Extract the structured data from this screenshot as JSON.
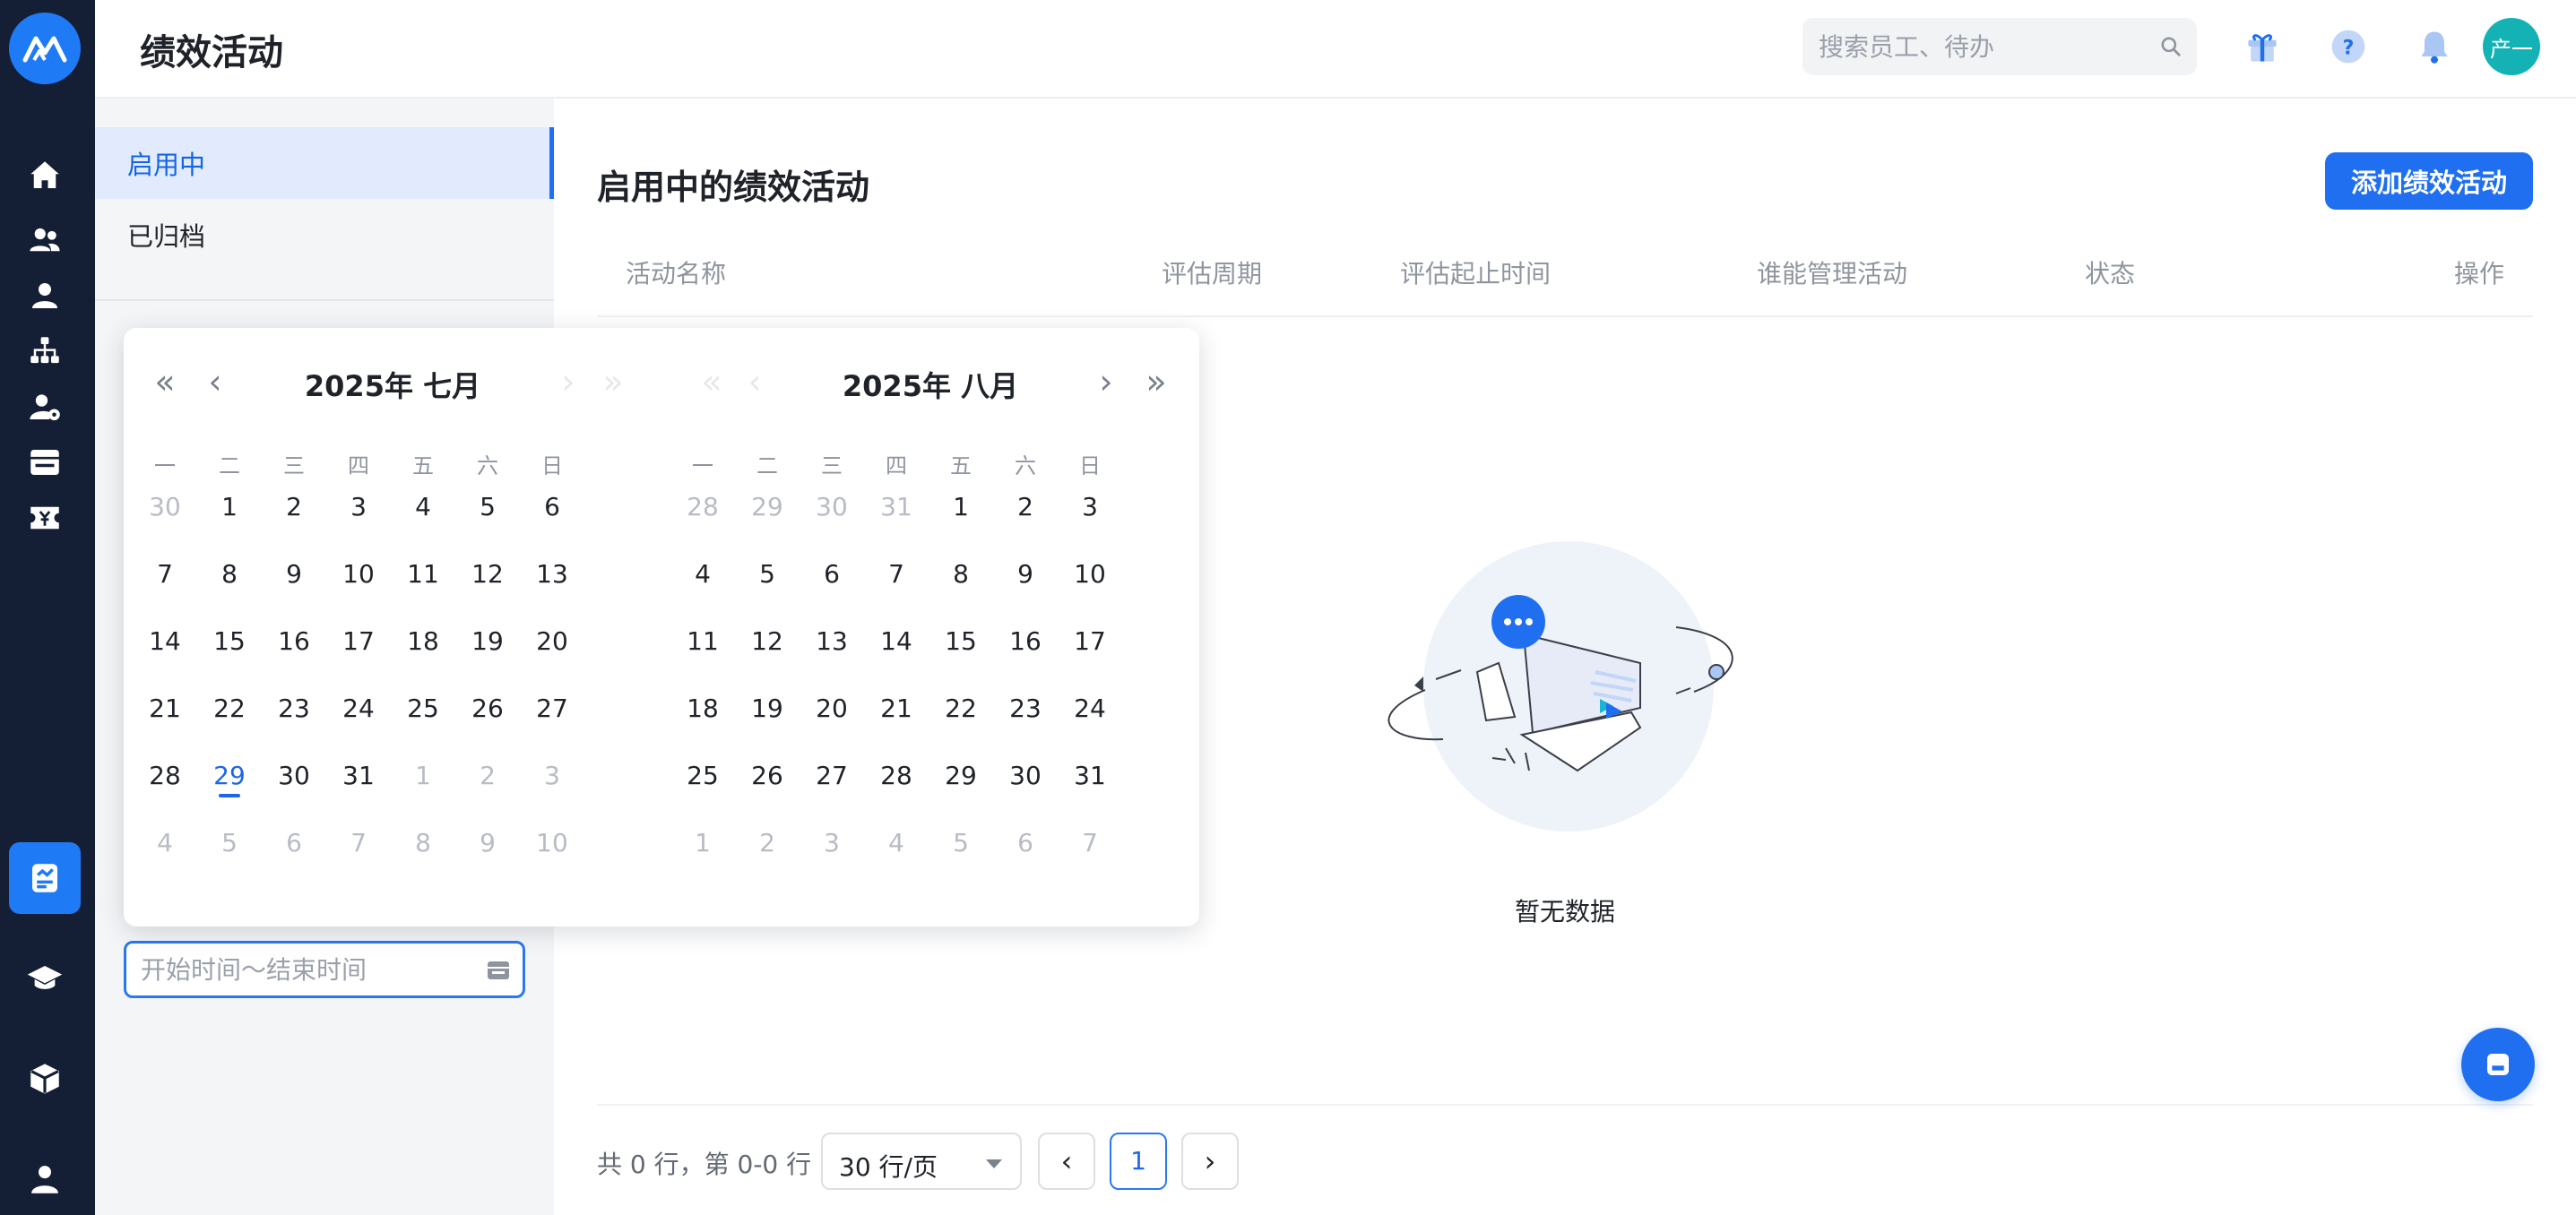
{
  "header": {
    "title": "绩效活动",
    "search_placeholder": "搜索员工、待办",
    "avatar_text": "产一"
  },
  "rail": {
    "items": [
      "home-icon",
      "team-icon",
      "person-icon",
      "org-chart-icon",
      "user-settings-icon",
      "calendar-icon",
      "payroll-icon",
      "performance-icon",
      "learning-icon",
      "box-icon",
      "profile-icon"
    ],
    "active": "performance-icon"
  },
  "subnav": {
    "items": [
      {
        "label": "启用中",
        "active": true
      },
      {
        "label": "已归档",
        "active": false
      }
    ],
    "date_range_placeholder": "开始时间～结束时间"
  },
  "calendar": {
    "weekdays": [
      "一",
      "二",
      "三",
      "四",
      "五",
      "六",
      "日"
    ],
    "left": {
      "title": "2025年 七月",
      "days": [
        [
          "30",
          "1",
          "2",
          "3",
          "4",
          "5",
          "6"
        ],
        [
          "7",
          "8",
          "9",
          "10",
          "11",
          "12",
          "13"
        ],
        [
          "14",
          "15",
          "16",
          "17",
          "18",
          "19",
          "20"
        ],
        [
          "21",
          "22",
          "23",
          "24",
          "25",
          "26",
          "27"
        ],
        [
          "28",
          "29",
          "30",
          "31",
          "1",
          "2",
          "3"
        ],
        [
          "4",
          "5",
          "6",
          "7",
          "8",
          "9",
          "10"
        ]
      ],
      "first_in_month": 1,
      "last_in_month": 31,
      "today": "29"
    },
    "right": {
      "title": "2025年 八月",
      "days": [
        [
          "28",
          "29",
          "30",
          "31",
          "1",
          "2",
          "3"
        ],
        [
          "4",
          "5",
          "6",
          "7",
          "8",
          "9",
          "10"
        ],
        [
          "11",
          "12",
          "13",
          "14",
          "15",
          "16",
          "17"
        ],
        [
          "18",
          "19",
          "20",
          "21",
          "22",
          "23",
          "24"
        ],
        [
          "25",
          "26",
          "27",
          "28",
          "29",
          "30",
          "31"
        ],
        [
          "1",
          "2",
          "3",
          "4",
          "5",
          "6",
          "7"
        ]
      ],
      "first_in_month": 4,
      "last_in_month": 34
    }
  },
  "main": {
    "title": "启用中的绩效活动",
    "add_button": "添加绩效活动",
    "columns": [
      "活动名称",
      "评估周期",
      "评估起止时间",
      "谁能管理活动",
      "状态",
      "操作"
    ],
    "empty_text": "暂无数据"
  },
  "pagination": {
    "info": "共 0 行，第 0-0 行",
    "page_size": "30 行/页",
    "prev": "‹",
    "current_page": "1",
    "next": "›"
  },
  "colors": {
    "accent": "#1f6ff0",
    "rail_bg": "#141e34",
    "avatar_bg": "#14b2b5"
  }
}
